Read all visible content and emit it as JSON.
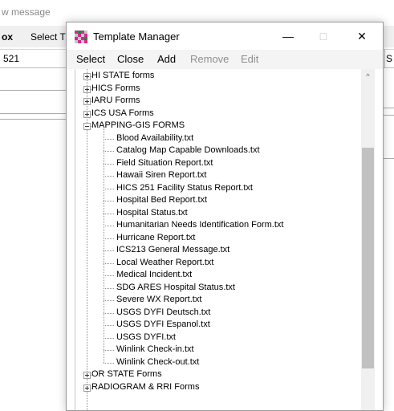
{
  "background_window": {
    "title_fragment": "w message",
    "menu_fragments": [
      "ox",
      "Select T"
    ],
    "header_left": "521",
    "header_right": "S"
  },
  "template_manager": {
    "title": "Template Manager",
    "controls": {
      "minimize": "—",
      "maximize": "□",
      "close": "✕"
    },
    "menu": [
      {
        "label": "Select",
        "enabled": true
      },
      {
        "label": "Close",
        "enabled": true
      },
      {
        "label": "Add",
        "enabled": true
      },
      {
        "label": "Remove",
        "enabled": false
      },
      {
        "label": "Edit",
        "enabled": false
      }
    ],
    "tree": {
      "groups_before": [
        {
          "label": "HI STATE forms",
          "expanded": false
        },
        {
          "label": "HICS Forms",
          "expanded": false
        },
        {
          "label": "IARU Forms",
          "expanded": false
        },
        {
          "label": "ICS USA Forms",
          "expanded": false
        }
      ],
      "expanded_group": {
        "label": "MAPPING-GIS FORMS",
        "children": [
          "Blood Availability.txt",
          "Catalog Map Capable Downloads.txt",
          "Field Situation Report.txt",
          "Hawaii Siren Report.txt",
          "HICS 251 Facility Status Report.txt",
          "Hospital Bed Report.txt",
          "Hospital Status.txt",
          "Humanitarian Needs Identification Form.txt",
          "Hurricane Report.txt",
          "ICS213 General Message.txt",
          "Local Weather Report.txt",
          "Medical Incident.txt",
          "SDG ARES Hospital Status.txt",
          "Severe WX Report.txt",
          "USGS DYFI Deutsch.txt",
          "USGS DYFI Espanol.txt",
          "USGS DYFI.txt",
          "Winlink Check-in.txt",
          "Winlink Check-out.txt"
        ]
      },
      "groups_after": [
        {
          "label": "OR STATE Forms",
          "expanded": false
        },
        {
          "label": "RADIOGRAM & RRI Forms",
          "expanded": false
        }
      ]
    },
    "scrollbar": {
      "up_arrow": "^"
    },
    "colors": {
      "border": "#9a9a9a",
      "menu_bg": "#f4f4f4",
      "thumb": "#c1c1c1"
    }
  }
}
